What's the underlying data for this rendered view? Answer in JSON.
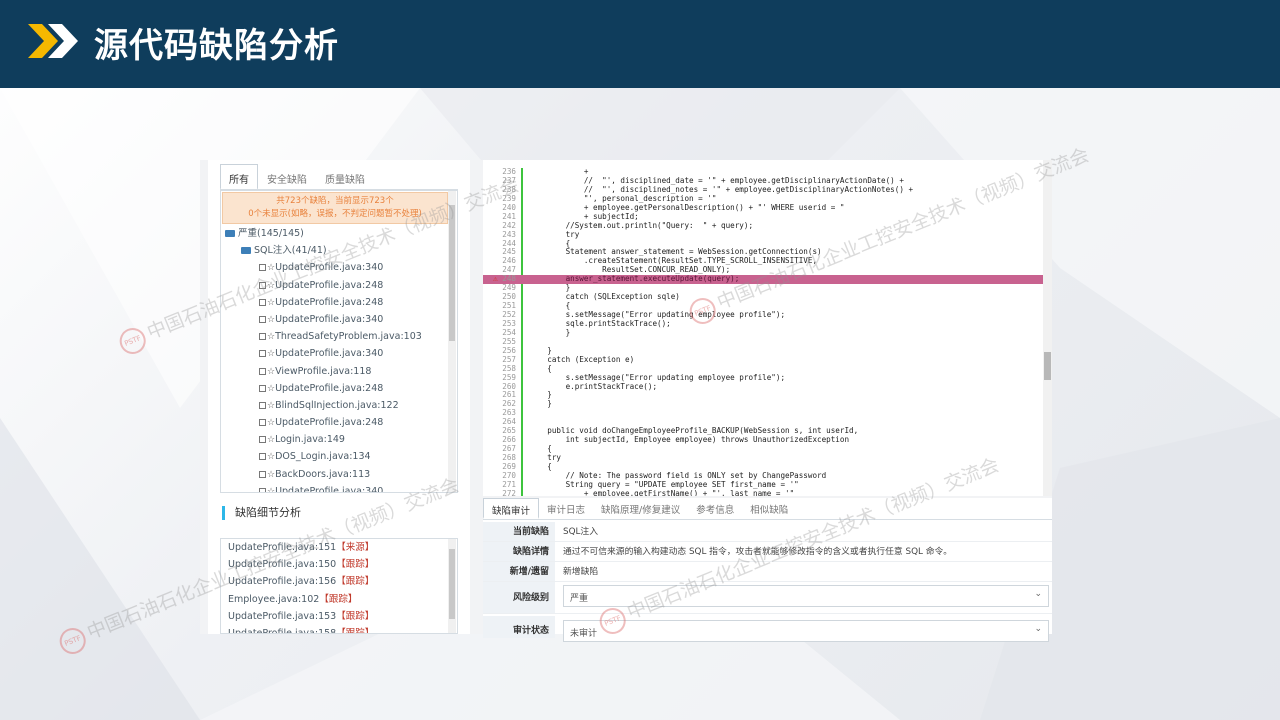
{
  "header": {
    "title": "源代码缺陷分析"
  },
  "left_tabs": [
    "所有",
    "安全缺陷",
    "质量缺陷"
  ],
  "notice": {
    "line1": "共723个缺陷，当前显示723个",
    "line2": "0个未显示(如略，误报，不判定问题暂不处理)"
  },
  "tree": {
    "severity": "严重(145/145)",
    "category": "SQL注入(41/41)",
    "items": [
      "UpdateProfile.java:340",
      "UpdateProfile.java:248",
      "UpdateProfile.java:248",
      "UpdateProfile.java:340",
      "ThreadSafetyProblem.java:103",
      "UpdateProfile.java:340",
      "ViewProfile.java:118",
      "UpdateProfile.java:248",
      "BlindSqlInjection.java:122",
      "UpdateProfile.java:248",
      "Login.java:149",
      "DOS_Login.java:134",
      "BackDoors.java:113",
      "UpdateProfile.java:340"
    ]
  },
  "detail": {
    "heading": "缺陷细节分析",
    "rows": [
      {
        "file": "UpdateProfile.java:151",
        "tag": "【来源】"
      },
      {
        "file": "UpdateProfile.java:150",
        "tag": "【跟踪】"
      },
      {
        "file": "UpdateProfile.java:156",
        "tag": "【跟踪】"
      },
      {
        "file": "Employee.java:102",
        "tag": "【跟踪】"
      },
      {
        "file": "UpdateProfile.java:153",
        "tag": "【跟踪】"
      },
      {
        "file": "UpdateProfile.java:158",
        "tag": "【跟踪】"
      }
    ]
  },
  "code": {
    "lines": [
      {
        "n": "236",
        "t": "            +"
      },
      {
        "n": "237",
        "t": "            //  \"', disciplined_date = '\" + employee.getDisciplinaryActionDate() +"
      },
      {
        "n": "238",
        "t": "            //  \"', disciplined_notes = '\" + employee.getDisciplinaryActionNotes() +"
      },
      {
        "n": "239",
        "t": "            \"', personal_description = '\""
      },
      {
        "n": "240",
        "t": "            + employee.getPersonalDescription() + \"' WHERE userid = \""
      },
      {
        "n": "241",
        "t": "            + subjectId;"
      },
      {
        "n": "242",
        "t": "        //System.out.println(\"Query:  \" + query);"
      },
      {
        "n": "243",
        "t": "        try"
      },
      {
        "n": "244",
        "t": "        {"
      },
      {
        "n": "245",
        "t": "        Statement answer_statement = WebSession.getConnection(s)"
      },
      {
        "n": "246",
        "t": "            .createStatement(ResultSet.TYPE_SCROLL_INSENSITIVE,"
      },
      {
        "n": "247",
        "t": "                ResultSet.CONCUR_READ_ONLY);"
      },
      {
        "n": "248",
        "t": "        answer_statement.executeUpdate(query);"
      },
      {
        "n": "249",
        "t": "        }"
      },
      {
        "n": "250",
        "t": "        catch (SQLException sqle)"
      },
      {
        "n": "251",
        "t": "        {"
      },
      {
        "n": "252",
        "t": "        s.setMessage(\"Error updating employee profile\");"
      },
      {
        "n": "253",
        "t": "        sqle.printStackTrace();"
      },
      {
        "n": "254",
        "t": "        }"
      },
      {
        "n": "255",
        "t": ""
      },
      {
        "n": "256",
        "t": "    }"
      },
      {
        "n": "257",
        "t": "    catch (Exception e)"
      },
      {
        "n": "258",
        "t": "    {"
      },
      {
        "n": "259",
        "t": "        s.setMessage(\"Error updating employee profile\");"
      },
      {
        "n": "260",
        "t": "        e.printStackTrace();"
      },
      {
        "n": "261",
        "t": "    }"
      },
      {
        "n": "262",
        "t": "    }"
      },
      {
        "n": "263",
        "t": ""
      },
      {
        "n": "264",
        "t": ""
      },
      {
        "n": "265",
        "t": "    public void doChangeEmployeeProfile_BACKUP(WebSession s, int userId,"
      },
      {
        "n": "266",
        "t": "        int subjectId, Employee employee) throws UnauthorizedException"
      },
      {
        "n": "267",
        "t": "    {"
      },
      {
        "n": "268",
        "t": "    try"
      },
      {
        "n": "269",
        "t": "    {"
      },
      {
        "n": "270",
        "t": "        // Note: The password field is ONLY set by ChangePassword"
      },
      {
        "n": "271",
        "t": "        String query = \"UPDATE employee SET first_name = '\""
      },
      {
        "n": "272",
        "t": "            + employee.getFirstName() + \"', last_name = '\""
      }
    ]
  },
  "bottom_tabs": [
    "缺陷审计",
    "审计日志",
    "缺陷原理/修复建议",
    "参考信息",
    "相似缺陷"
  ],
  "props": [
    {
      "label": "当前缺陷",
      "value": "SQL注入"
    },
    {
      "label": "缺陷详情",
      "value": "通过不可信来源的输入构建动态 SQL 指令，攻击者就能够修改指令的含义或者执行任意 SQL 命令。"
    },
    {
      "label": "新增/遗留",
      "value": "新增缺陷"
    },
    {
      "label": "风险级别",
      "value": "严重"
    },
    {
      "label": "审计状态",
      "value": "未审计"
    }
  ]
}
